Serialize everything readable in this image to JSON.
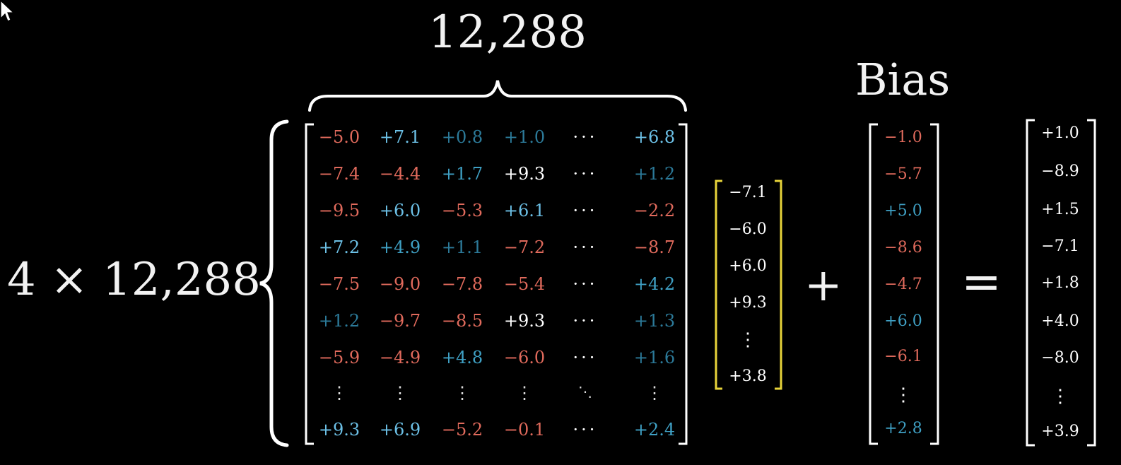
{
  "labels": {
    "top_dim": "12,288",
    "left_dim": "4 × 12,288",
    "bias": "Bias",
    "plus": "+",
    "equals": "="
  },
  "colors": {
    "negative": "#e06a5c",
    "positive_strong": "#6cc0e6",
    "positive_mid": "#3fa0c4",
    "positive_weak": "#2c7a99",
    "neutral": "#ffffff",
    "input_bracket": "#e8d43a",
    "bracket": "#ffffff"
  },
  "matrix": {
    "rows": [
      [
        {
          "v": "−5.0",
          "c": "negative"
        },
        {
          "v": "+7.1",
          "c": "positive_strong"
        },
        {
          "v": "+0.8",
          "c": "positive_weak"
        },
        {
          "v": "+1.0",
          "c": "positive_weak"
        },
        {
          "v": "···",
          "c": "neutral"
        },
        {
          "v": "+6.8",
          "c": "positive_strong"
        }
      ],
      [
        {
          "v": "−7.4",
          "c": "negative"
        },
        {
          "v": "−4.4",
          "c": "negative"
        },
        {
          "v": "+1.7",
          "c": "positive_mid"
        },
        {
          "v": "+9.3",
          "c": "neutral"
        },
        {
          "v": "···",
          "c": "neutral"
        },
        {
          "v": "+1.2",
          "c": "positive_weak"
        }
      ],
      [
        {
          "v": "−9.5",
          "c": "negative"
        },
        {
          "v": "+6.0",
          "c": "positive_strong"
        },
        {
          "v": "−5.3",
          "c": "negative"
        },
        {
          "v": "+6.1",
          "c": "positive_strong"
        },
        {
          "v": "···",
          "c": "neutral"
        },
        {
          "v": "−2.2",
          "c": "negative"
        }
      ],
      [
        {
          "v": "+7.2",
          "c": "positive_strong"
        },
        {
          "v": "+4.9",
          "c": "positive_mid"
        },
        {
          "v": "+1.1",
          "c": "positive_weak"
        },
        {
          "v": "−7.2",
          "c": "negative"
        },
        {
          "v": "···",
          "c": "neutral"
        },
        {
          "v": "−8.7",
          "c": "negative"
        }
      ],
      [
        {
          "v": "−7.5",
          "c": "negative"
        },
        {
          "v": "−9.0",
          "c": "negative"
        },
        {
          "v": "−7.8",
          "c": "negative"
        },
        {
          "v": "−5.4",
          "c": "negative"
        },
        {
          "v": "···",
          "c": "neutral"
        },
        {
          "v": "+4.2",
          "c": "positive_mid"
        }
      ],
      [
        {
          "v": "+1.2",
          "c": "positive_weak"
        },
        {
          "v": "−9.7",
          "c": "negative"
        },
        {
          "v": "−8.5",
          "c": "negative"
        },
        {
          "v": "+9.3",
          "c": "neutral"
        },
        {
          "v": "···",
          "c": "neutral"
        },
        {
          "v": "+1.3",
          "c": "positive_weak"
        }
      ],
      [
        {
          "v": "−5.9",
          "c": "negative"
        },
        {
          "v": "−4.9",
          "c": "negative"
        },
        {
          "v": "+4.8",
          "c": "positive_mid"
        },
        {
          "v": "−6.0",
          "c": "negative"
        },
        {
          "v": "···",
          "c": "neutral"
        },
        {
          "v": "+1.6",
          "c": "positive_weak"
        }
      ],
      "vdots",
      [
        {
          "v": "+9.3",
          "c": "positive_strong"
        },
        {
          "v": "+6.9",
          "c": "positive_strong"
        },
        {
          "v": "−5.2",
          "c": "negative"
        },
        {
          "v": "−0.1",
          "c": "negative"
        },
        {
          "v": "···",
          "c": "neutral"
        },
        {
          "v": "+2.4",
          "c": "positive_mid"
        }
      ]
    ]
  },
  "input_vector": [
    {
      "v": "−7.1",
      "c": "neutral"
    },
    {
      "v": "−6.0",
      "c": "neutral"
    },
    {
      "v": "+6.0",
      "c": "neutral"
    },
    {
      "v": "+9.3",
      "c": "neutral"
    },
    {
      "v": "⋮",
      "c": "neutral"
    },
    {
      "v": "+3.8",
      "c": "neutral"
    }
  ],
  "bias_vector": [
    {
      "v": "−1.0",
      "c": "negative"
    },
    {
      "v": "−5.7",
      "c": "negative"
    },
    {
      "v": "+5.0",
      "c": "positive_mid"
    },
    {
      "v": "−8.6",
      "c": "negative"
    },
    {
      "v": "−4.7",
      "c": "negative"
    },
    {
      "v": "+6.0",
      "c": "positive_mid"
    },
    {
      "v": "−6.1",
      "c": "negative"
    },
    {
      "v": "⋮",
      "c": "neutral"
    },
    {
      "v": "+2.8",
      "c": "positive_mid"
    }
  ],
  "output_vector": [
    {
      "v": "+1.0",
      "c": "neutral"
    },
    {
      "v": "−8.9",
      "c": "neutral"
    },
    {
      "v": "+1.5",
      "c": "neutral"
    },
    {
      "v": "−7.1",
      "c": "neutral"
    },
    {
      "v": "+1.8",
      "c": "neutral"
    },
    {
      "v": "+4.0",
      "c": "neutral"
    },
    {
      "v": "−8.0",
      "c": "neutral"
    },
    {
      "v": "⋮",
      "c": "neutral"
    },
    {
      "v": "+3.9",
      "c": "neutral"
    }
  ]
}
